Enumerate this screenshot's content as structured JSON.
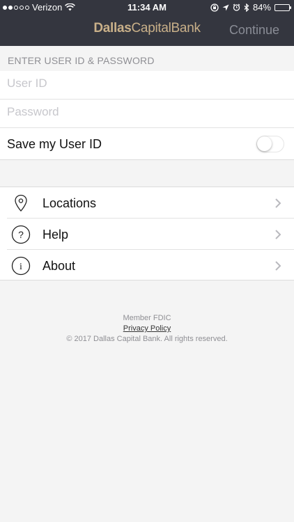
{
  "status_bar": {
    "carrier": "Verizon",
    "time": "11:34 AM",
    "battery": "84%",
    "battery_level": 0.84,
    "icons": [
      "signal-dots",
      "wifi-icon",
      "lock-rotation-icon",
      "location-arrow-icon",
      "alarm-icon",
      "bluetooth-icon",
      "battery-icon"
    ]
  },
  "header": {
    "brand_part1": "Dallas",
    "brand_part2": "CapitalBank",
    "continue_label": "Continue"
  },
  "login": {
    "section_title": "ENTER USER ID & PASSWORD",
    "user_id_placeholder": "User ID",
    "password_placeholder": "Password",
    "save_label": "Save my User ID",
    "save_enabled": false
  },
  "menu": {
    "items": [
      {
        "label": "Locations",
        "icon": "location-pin-icon"
      },
      {
        "label": "Help",
        "icon": "question-circle-icon"
      },
      {
        "label": "About",
        "icon": "info-circle-icon"
      }
    ]
  },
  "footer": {
    "member": "Member FDIC",
    "privacy": "Privacy Policy",
    "copyright": "© 2017 Dallas Capital Bank. All rights reserved."
  },
  "colors": {
    "header_bg": "#34363f",
    "brand_gold": "#c9b089",
    "continue_disabled": "#8a8d96",
    "page_bg": "#f4f4f4"
  }
}
